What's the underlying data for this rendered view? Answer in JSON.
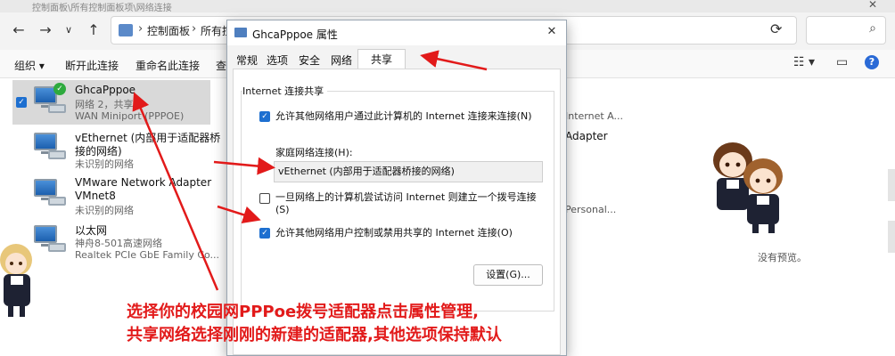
{
  "window": {
    "title": "控制面板\\所有控制面板项\\网络连接",
    "close": "✕"
  },
  "address": {
    "crumb1": "控制面板",
    "crumb2": "所有控",
    "sep": "›"
  },
  "commands": {
    "organize": "组织",
    "disconnect": "断开此连接",
    "rename": "重命名此连接",
    "view": "查"
  },
  "connections": [
    {
      "name": "GhcaPppoe",
      "line2": "网络 2，共享的",
      "line3": "WAN Miniport (PPPOE)"
    },
    {
      "name": "vEthernet (内部用于适配器桥",
      "line2": "接的网络)",
      "line3": "未识别的网络"
    },
    {
      "name": "VMware Network Adapter",
      "line2": "VMnet8",
      "line3": "未识别的网络"
    },
    {
      "name": "以太网",
      "line2": "神舟8-501高速网络",
      "line3": "Realtek PCIe GbE Family Co..."
    }
  ],
  "right_column": {
    "item1": "Internet A...",
    "item2": "Adapter",
    "item3": "Personal...",
    "no_preview": "没有预览。"
  },
  "dialog": {
    "title": "GhcaPppoe 属性",
    "tabs": [
      "常规",
      "选项",
      "安全",
      "网络",
      "共享"
    ],
    "active_tab": "共享",
    "group_label": "Internet 连接共享",
    "opt_allow": "允许其他网络用户通过此计算机的 Internet 连接来连接(N)",
    "home_label": "家庭网络连接(H):",
    "home_value": "vEthernet (内部用于适配器桥接的网络)",
    "opt_dial": "一旦网络上的计算机尝试访问 Internet 则建立一个拨号连接(S)",
    "opt_control": "允许其他网络用户控制或禁用共享的 Internet 连接(O)",
    "settings_btn": "设置(G)..."
  },
  "annotation": {
    "line1": "选择你的校园网PPPoe拨号适配器点击属性管理,",
    "line2": "共享网络选择刚刚的新建的适配器,其他选项保持默认"
  },
  "colors": {
    "accent": "#1d6fd0",
    "annotation": "#e21a1a"
  }
}
